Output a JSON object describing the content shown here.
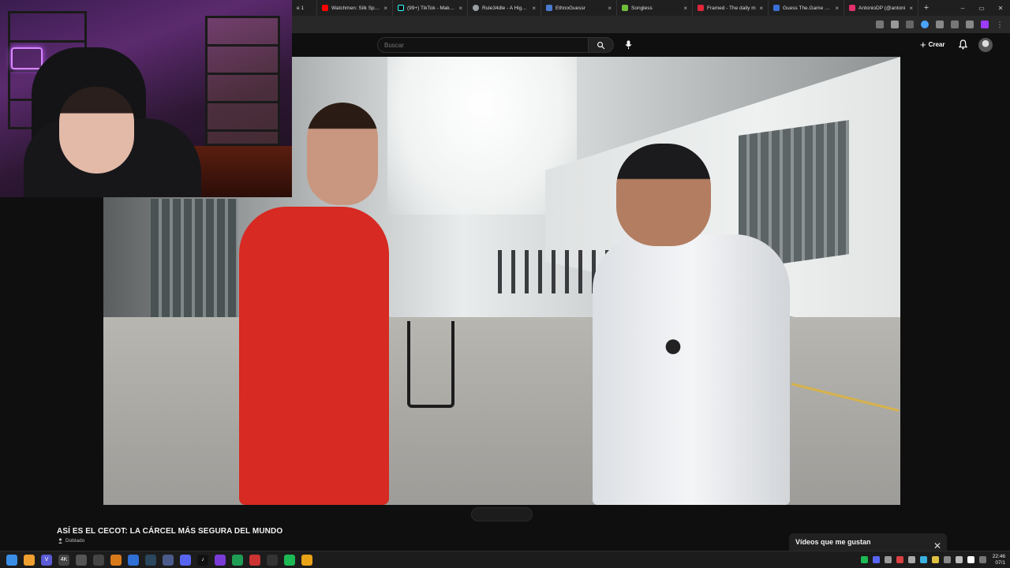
{
  "browser": {
    "tabs": [
      {
        "title": "e 1",
        "color": "#888888"
      },
      {
        "title": "Watchmen: Silk Spectr",
        "color": "#ff0000"
      },
      {
        "title": "(99+) TikTok - Make Yo",
        "color": "#111111"
      },
      {
        "title": "Rule34dle - A Higher o",
        "color": "#9aa0a6"
      },
      {
        "title": "EthnoGuessr",
        "color": "#4a7bd0"
      },
      {
        "title": "Songless",
        "color": "#6fbf3a"
      },
      {
        "title": "Framed - The daily m",
        "color": "#e0263a"
      },
      {
        "title": "Guess The.Game #133",
        "color": "#3b6fd8"
      },
      {
        "title": "AntonioDP (@antoni",
        "color": "#e1306c"
      }
    ],
    "new_tab": "+",
    "window_controls": [
      "–",
      "▭",
      "✕"
    ]
  },
  "youtube": {
    "search_placeholder": "Buscar",
    "create_label": "Crear",
    "video_title": "ASÍ ES EL CECOT: LA CÁRCEL MÁS SEGURA DEL MUNDO",
    "audio_label": "Doblado",
    "liked_panel_title": "Vídeos que me gustan",
    "close_glyph": "✕"
  },
  "taskbar": {
    "apps": [
      {
        "icon": "windows-start-icon",
        "color": "#3a8ee6"
      },
      {
        "icon": "search-icon",
        "color": "#f0a030"
      },
      {
        "icon": "vpn-icon",
        "color": "#5b5bd6",
        "glyph": "V"
      },
      {
        "icon": "app-4k-icon",
        "color": "#444444",
        "glyph": "4K"
      },
      {
        "icon": "media-icon",
        "color": "#555555"
      },
      {
        "icon": "disk-icon",
        "color": "#444444"
      },
      {
        "icon": "shield-icon",
        "color": "#d97a1a"
      },
      {
        "icon": "browser-icon",
        "color": "#2f6fd6"
      },
      {
        "icon": "steam-icon",
        "color": "#2a475e"
      },
      {
        "icon": "game-icon",
        "color": "#4a5a8a"
      },
      {
        "icon": "discord-icon",
        "color": "#5865f2"
      },
      {
        "icon": "tiktok-icon",
        "color": "#111111",
        "glyph": "♪"
      },
      {
        "icon": "editor-icon",
        "color": "#7a3cd6"
      },
      {
        "icon": "sheets-icon",
        "color": "#1f9d55"
      },
      {
        "icon": "refresh-icon",
        "color": "#cc3333"
      },
      {
        "icon": "obs-icon",
        "color": "#333333"
      },
      {
        "icon": "spotify-icon",
        "color": "#1db954"
      },
      {
        "icon": "chrome-icon",
        "color": "#e8a317"
      }
    ],
    "tray_colors": [
      "#1db954",
      "#5865f2",
      "#999999",
      "#d94040",
      "#aaaaaa",
      "#3ab0e0",
      "#e0c040",
      "#888888",
      "#bbbbbb",
      "#ffffff",
      "#777777"
    ],
    "time": "22:46",
    "date": "07/1"
  }
}
